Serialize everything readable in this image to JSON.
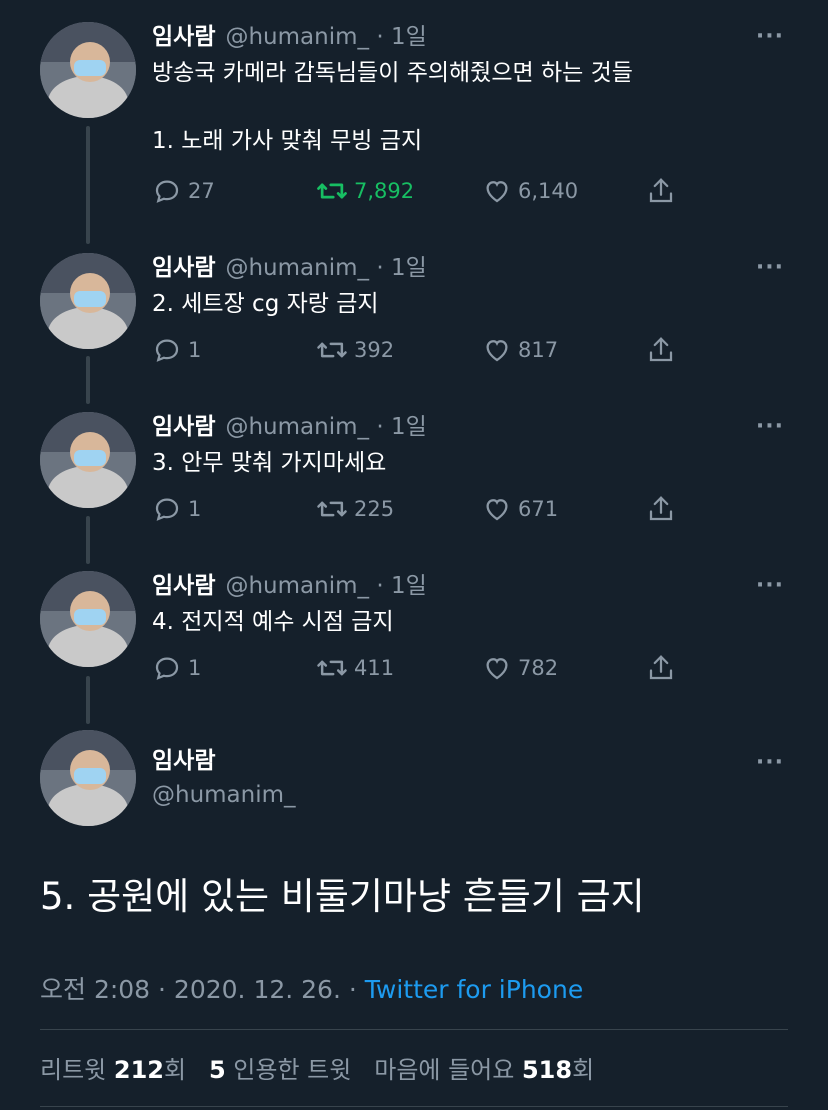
{
  "author": {
    "name": "임사람",
    "handle": "@humanim_",
    "time_meta": "· 1일"
  },
  "more_icon": "···",
  "tweets": [
    {
      "text": "방송국 카메라 감독님들이 주의해줬으면 하는 것들\n\n1. 노래 가사 맞춰 무빙 금지",
      "replies": "27",
      "retweets": "7,892",
      "likes": "6,140"
    },
    {
      "text": "2. 세트장 cg 자랑 금지",
      "replies": "1",
      "retweets": "392",
      "likes": "817"
    },
    {
      "text": "3. 안무 맞춰 가지마세요",
      "replies": "1",
      "retweets": "225",
      "likes": "671"
    },
    {
      "text": "4. 전지적 예수 시점 금지",
      "replies": "1",
      "retweets": "411",
      "likes": "782"
    }
  ],
  "main_tweet": {
    "name": "임사람",
    "handle": "@humanim_",
    "text": "5. 공원에 있는 비둘기마냥 흔들기 금지",
    "time": "오전 2:08 · 2020. 12. 26. · ",
    "source": "Twitter for iPhone"
  },
  "stats": {
    "retweet_label": "리트윗 ",
    "retweet_count": "212",
    "retweet_unit": "회",
    "quote_count": "5",
    "quote_label": " 인용한 트윗",
    "like_label": "마음에 들어요 ",
    "like_count": "518",
    "like_unit": "회"
  },
  "colors": {
    "background": "#15202b",
    "secondary": "#8b98a5",
    "retweet_active": "#17bf63",
    "link": "#1d9bf0"
  },
  "icons": [
    "reply-icon",
    "retweet-icon",
    "like-icon",
    "share-icon",
    "more-icon",
    "avatar"
  ]
}
